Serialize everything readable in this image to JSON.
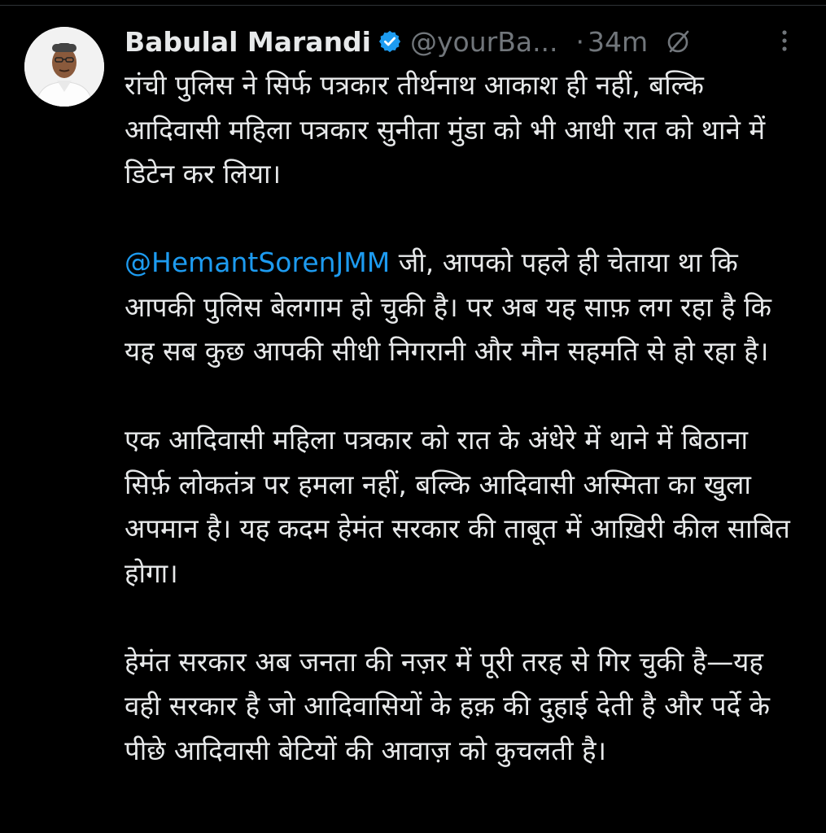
{
  "tweet": {
    "author_name": "Babulal Marandi",
    "handle": "@yourBa...",
    "separator": "·",
    "time": "34m",
    "icons": {
      "verified": "verified-badge-icon",
      "grok": "grok-icon",
      "more": "more-vertical-icon"
    },
    "colors": {
      "background": "#000000",
      "text": "#e7e9ea",
      "muted": "#71767b",
      "link": "#1d9bf0"
    },
    "paragraphs": {
      "p1": "रांची पुलिस ने सिर्फ पत्रकार तीर्थनाथ आकाश ही नहीं, बल्कि आदिवासी महिला पत्रकार सुनीता मुंडा को भी आधी रात को थाने में डिटेन कर लिया।",
      "p2_mention": "@HemantSorenJMM",
      "p2_text": " जी, आपको पहले ही चेताया था कि आपकी पुलिस बेलगाम हो चुकी है। पर अब यह साफ़ लग रहा है कि यह सब कुछ आपकी सीधी निगरानी और मौन सहमति से हो रहा है।",
      "p3": "एक आदिवासी महिला पत्रकार को रात के अंधेरे में थाने में बिठाना सिर्फ़ लोकतंत्र पर हमला नहीं, बल्कि आदिवासी अस्मिता का खुला अपमान है। यह कदम हेमंत सरकार की ताबूत में आख़िरी कील साबित होगा।",
      "p4": "हेमंत सरकार अब जनता की नज़र में पूरी तरह से गिर चुकी है—यह वही सरकार है जो आदिवासियों के हक़ की दुहाई देती है और पर्दे के पीछे आदिवासी बेटियों की आवाज़ को कुचलती है।"
    }
  }
}
